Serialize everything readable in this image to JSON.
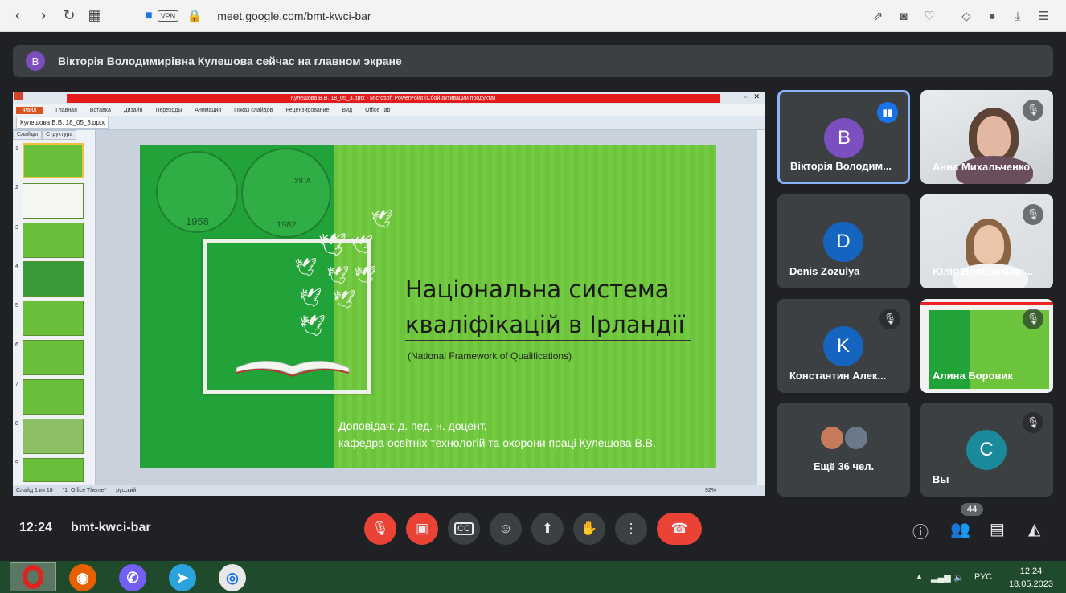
{
  "browser": {
    "url": "meet.google.com/bmt-kwci-bar",
    "vpn_label": "VPN",
    "icons": [
      "back-icon",
      "forward-icon",
      "reload-icon",
      "grid-icon",
      "camera-icon",
      "lock-icon",
      "share-icon",
      "screenshot-icon",
      "heart-icon",
      "cube-icon",
      "profile-icon",
      "download-icon",
      "menu-icon"
    ]
  },
  "banner": {
    "avatar_letter": "B",
    "text": "Вікторія Володимирівна Кулешова сейчас на главном экране"
  },
  "powerpoint": {
    "window_title": "Кулешова В.В. 18_05_3.pptx - Microsoft PowerPoint (Сбой активации продукта)",
    "menu": [
      "Файл",
      "Главная",
      "Вставка",
      "Дизайн",
      "Переходы",
      "Анимация",
      "Показ слайдов",
      "Рецензирование",
      "Вид",
      "Office Tab"
    ],
    "doc_tab": "Кулешова В.В. 18_05_3.pptx",
    "panel_tabs": [
      "Слайды",
      "Структура"
    ],
    "thumb_numbers": [
      "1",
      "2",
      "3",
      "4",
      "5",
      "6",
      "7",
      "8",
      "9"
    ],
    "status": [
      "Слайд 1 из 18",
      "\"1_Office Theme\"",
      "русский"
    ],
    "zoom": "92%"
  },
  "slide": {
    "title_line1": "Національна система",
    "title_line2": "кваліфікацій в Ірландії",
    "subtitle": "(National Framework of Qualifications)",
    "speaker_line1": "Доповідач: д. пед. н. доцент,",
    "speaker_line2": "кафедра освітніх технологій та охорони праці Кулешова В.В.",
    "seal1_year": "1958",
    "seal2_year": "1982",
    "seal2_abbrev": "УІПА"
  },
  "tiles": [
    {
      "name": "Вікторія Володим...",
      "letter": "B",
      "color": "#7b4fbf"
    },
    {
      "name": "Анна Михальченко"
    },
    {
      "name": "Denis Zozulya",
      "letter": "D",
      "color": "#1565c0"
    },
    {
      "name": "Юлія Володимирі..."
    },
    {
      "name": "Константин Алек...",
      "letter": "K",
      "color": "#1565c0"
    },
    {
      "name": "Алина Боровик"
    },
    {
      "name": "Ещё 36 чел."
    },
    {
      "name": "Вы",
      "letter": "C",
      "color": "#1a8a9a"
    }
  ],
  "bottom": {
    "time": "12:24",
    "meeting_code": "bmt-kwci-bar",
    "participants_count": "44"
  },
  "taskbar": {
    "lang": "РУС",
    "time": "12:24",
    "date": "18.05.2023"
  }
}
